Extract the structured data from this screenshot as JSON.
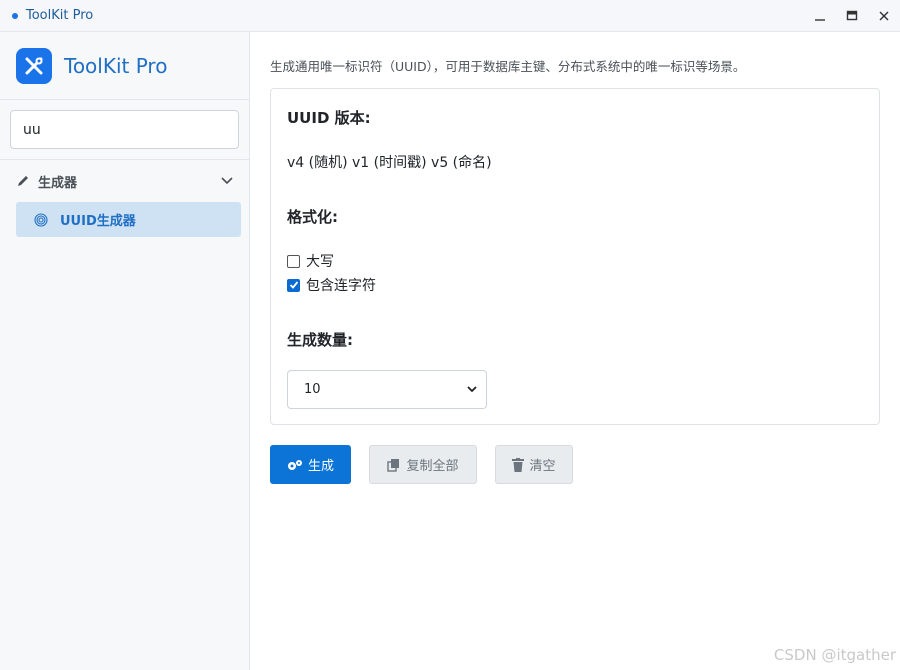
{
  "window": {
    "title": "ToolKit Pro"
  },
  "sidebar": {
    "brand": "ToolKit Pro",
    "search": {
      "value": "uu",
      "placeholder": ""
    },
    "groups": [
      {
        "label": "生成器",
        "items": [
          {
            "label": "UUID生成器",
            "active": true
          }
        ]
      }
    ]
  },
  "main": {
    "description": "生成通用唯一标识符（UUID），可用于数据库主键、分布式系统中的唯一标识等场景。",
    "version": {
      "title": "UUID 版本:",
      "options_text": "v4 (随机) v1 (时间戳) v5 (命名)"
    },
    "format": {
      "title": "格式化:",
      "options": [
        {
          "label": "大写",
          "checked": false
        },
        {
          "label": "包含连字符",
          "checked": true
        }
      ]
    },
    "count": {
      "title": "生成数量:",
      "selected": "10"
    },
    "buttons": {
      "generate": "生成",
      "copy_all": "复制全部",
      "clear": "清空"
    }
  },
  "watermark": "CSDN @itgather",
  "colors": {
    "accent": "#0b74d6",
    "sidebar_active": "#cfe2f3",
    "brand_text": "#1f6fc5"
  }
}
